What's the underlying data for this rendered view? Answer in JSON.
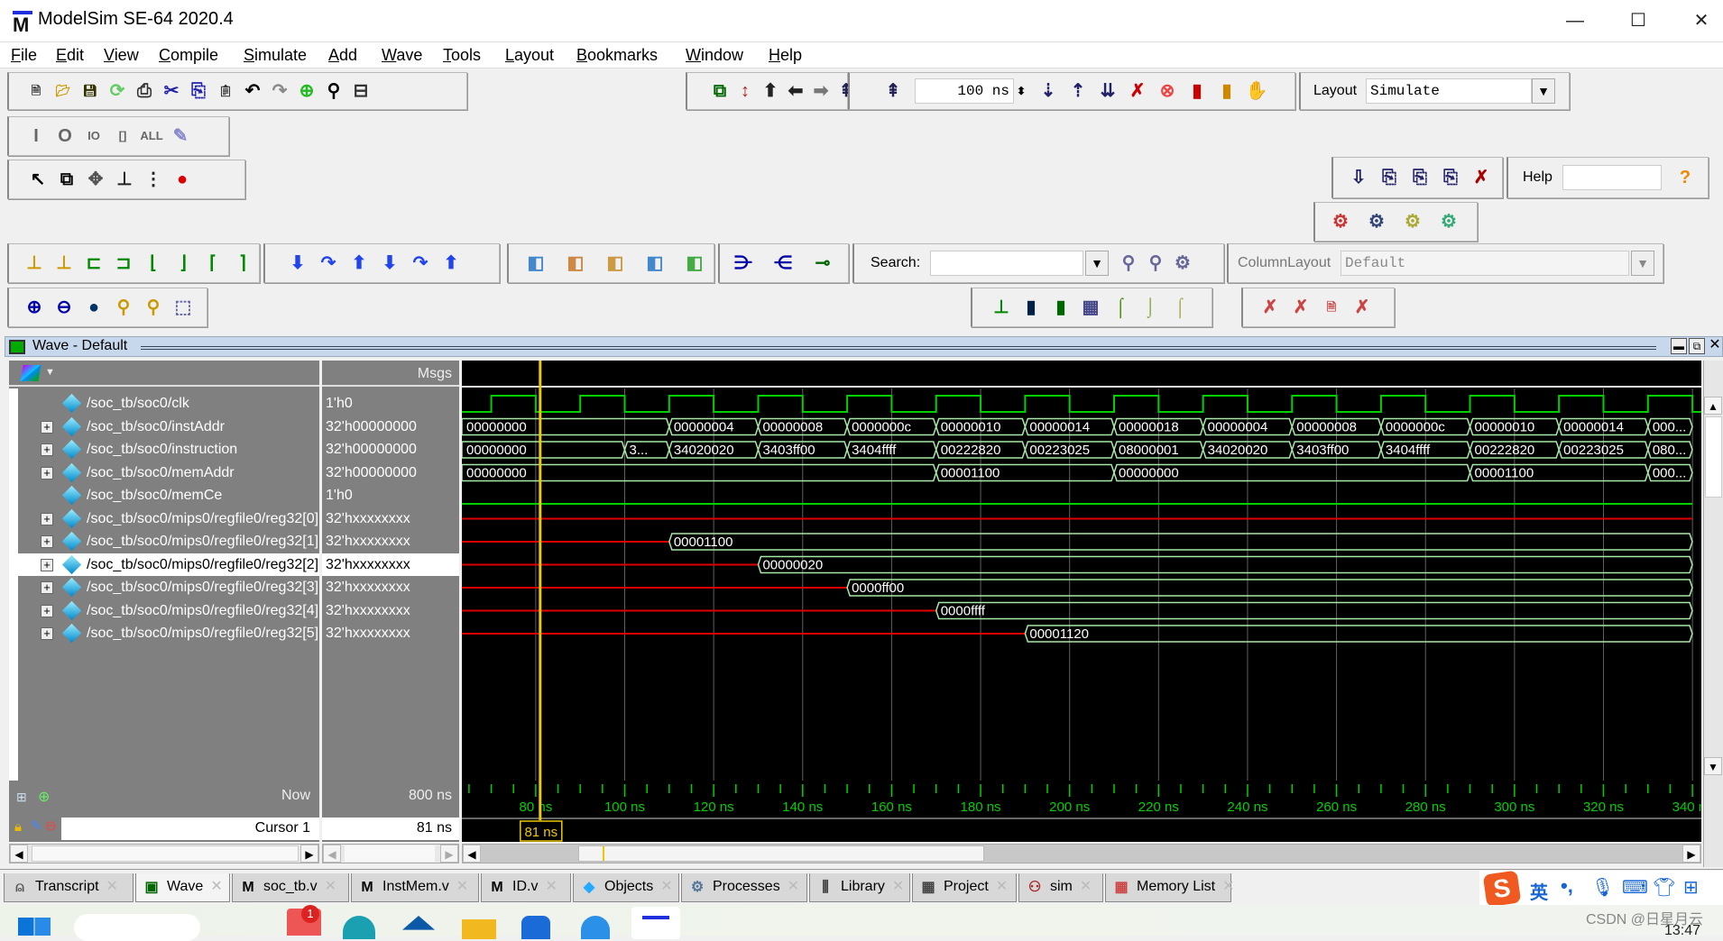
{
  "window": {
    "title": "ModelSim SE-64 2020.4",
    "controls": [
      "minimize",
      "maximize",
      "close"
    ]
  },
  "menu": [
    "File",
    "Edit",
    "View",
    "Compile",
    "Simulate",
    "Add",
    "Wave",
    "Tools",
    "Layout",
    "Bookmarks",
    "Window",
    "Help"
  ],
  "toolbar": {
    "run_length": "100 ns",
    "layout_label": "Layout",
    "layout_value": "Simulate",
    "help_label": "Help",
    "help_value": "",
    "search_label": "Search:",
    "search_value": "",
    "column_layout_label": "ColumnLayout",
    "column_layout_value": "Default",
    "groups": [
      [
        "new-file-icon",
        "open-folder-icon",
        "save-icon",
        "reload-icon",
        "print-icon",
        "cut-icon",
        "copy-icon",
        "paste-icon",
        "undo-icon",
        "redo-icon",
        "add-icon",
        "find-icon",
        "hierarchy-icon"
      ],
      [
        "compile-icon",
        "restart-icon",
        "up-icon",
        "back-icon",
        "forward-icon",
        "run-length-icon"
      ],
      [
        "run-icon",
        "continue-icon",
        "run-all-icon",
        "break-icon",
        "stop-icon",
        "performance-icon",
        "memory-profile-icon",
        "hand-icon"
      ],
      [
        "filter-input-icon",
        "filter-output-icon",
        "filter-inout-icon",
        "filter-internal-icon",
        "filter-all-icon",
        "wildcard-icon"
      ],
      [
        "select-mode-icon",
        "zoom-mode-icon",
        "pan-mode-icon",
        "cursor-mode-icon",
        "edit-mode-icon",
        "stop-light-icon"
      ],
      [
        "step-into-icon",
        "step-icon",
        "step-out-icon",
        "step-over-icon",
        "step-back-icon"
      ],
      [
        "gear-red-icon",
        "gear-blue-icon",
        "gear-yellow-icon",
        "gear-green-icon"
      ],
      [
        "help-search-icon"
      ],
      [
        "insert-cursor-icon",
        "delete-cursor-icon",
        "prev-edge-icon",
        "next-edge-icon",
        "prev-falling-icon",
        "next-falling-icon",
        "prev-rising-icon",
        "next-rising-icon"
      ],
      [
        "step-down-icon",
        "step-over-arrow-icon",
        "step-up-icon",
        "step-down-group-icon",
        "step-over-group-icon",
        "step-up-group-icon"
      ],
      [
        "add-wave-icon",
        "remove-wave-icon",
        "edit-wave-icon",
        "save-wave-icon",
        "export-wave-icon"
      ],
      [
        "expand-icon",
        "collapse-icon",
        "trace-icon"
      ],
      [
        "find-prev-icon",
        "find-next-icon",
        "search-options-icon"
      ],
      [
        "zoom-in-icon",
        "zoom-out-icon",
        "zoom-full-icon",
        "zoom-cursor-icon",
        "zoom-cursors-icon",
        "zoom-region-icon"
      ],
      [
        "wave-line-icon",
        "wave-bar-icon",
        "wave-fill-icon",
        "wave-grid-icon",
        "edge-icon",
        "edge-falling-icon",
        "edge-rising-icon"
      ],
      [
        "prev-diff-icon",
        "next-diff-icon",
        "diff-doc-icon",
        "clear-diff-icon"
      ]
    ]
  },
  "wave": {
    "title": "Wave - Default",
    "msgs_label": "Msgs",
    "selected_row": 7,
    "signals": [
      {
        "name": "/soc_tb/soc0/clk",
        "value": "1'h0",
        "kind": "clock",
        "expandable": false,
        "period_ns": 20,
        "rise_ns": 70,
        "high_ns": 10
      },
      {
        "name": "/soc_tb/soc0/instAddr",
        "value": "32'h00000000",
        "kind": "bus",
        "expandable": true,
        "segments": [
          [
            0,
            "00000000"
          ],
          [
            110,
            "00000004"
          ],
          [
            130,
            "00000008"
          ],
          [
            150,
            "0000000c"
          ],
          [
            170,
            "00000010"
          ],
          [
            190,
            "00000014"
          ],
          [
            210,
            "00000018"
          ],
          [
            230,
            "00000004"
          ],
          [
            250,
            "00000008"
          ],
          [
            270,
            "0000000c"
          ],
          [
            290,
            "00000010"
          ],
          [
            310,
            "00000014"
          ],
          [
            330,
            "000..."
          ]
        ]
      },
      {
        "name": "/soc_tb/soc0/instruction",
        "value": "32'h00000000",
        "kind": "bus",
        "expandable": true,
        "segments": [
          [
            0,
            "00000000"
          ],
          [
            100,
            "3..."
          ],
          [
            110,
            "34020020"
          ],
          [
            130,
            "3403ff00"
          ],
          [
            150,
            "3404ffff"
          ],
          [
            170,
            "00222820"
          ],
          [
            190,
            "00223025"
          ],
          [
            210,
            "08000001"
          ],
          [
            230,
            "34020020"
          ],
          [
            250,
            "3403ff00"
          ],
          [
            270,
            "3404ffff"
          ],
          [
            290,
            "00222820"
          ],
          [
            310,
            "00223025"
          ],
          [
            330,
            "080..."
          ]
        ]
      },
      {
        "name": "/soc_tb/soc0/memAddr",
        "value": "32'h00000000",
        "kind": "bus",
        "expandable": true,
        "segments": [
          [
            0,
            "00000000"
          ],
          [
            170,
            "00001100"
          ],
          [
            210,
            "00000000"
          ],
          [
            290,
            "00001100"
          ],
          [
            330,
            "000..."
          ]
        ]
      },
      {
        "name": "/soc_tb/soc0/memCe",
        "value": "1'h0",
        "kind": "bit",
        "expandable": false,
        "level": 0
      },
      {
        "name": "/soc_tb/soc0/mips0/regfile0/reg32[0]",
        "value": "32'hxxxxxxxx",
        "kind": "bus",
        "expandable": true,
        "segments": [
          [
            0,
            "x"
          ]
        ]
      },
      {
        "name": "/soc_tb/soc0/mips0/regfile0/reg32[1]",
        "value": "32'hxxxxxxxx",
        "kind": "bus",
        "expandable": true,
        "segments": [
          [
            0,
            "x"
          ],
          [
            110,
            "00001100"
          ]
        ]
      },
      {
        "name": "/soc_tb/soc0/mips0/regfile0/reg32[2]",
        "value": "32'hxxxxxxxx",
        "kind": "bus",
        "expandable": true,
        "segments": [
          [
            0,
            "x"
          ],
          [
            130,
            "00000020"
          ]
        ]
      },
      {
        "name": "/soc_tb/soc0/mips0/regfile0/reg32[3]",
        "value": "32'hxxxxxxxx",
        "kind": "bus",
        "expandable": true,
        "segments": [
          [
            0,
            "x"
          ],
          [
            150,
            "0000ff00"
          ]
        ]
      },
      {
        "name": "/soc_tb/soc0/mips0/regfile0/reg32[4]",
        "value": "32'hxxxxxxxx",
        "kind": "bus",
        "expandable": true,
        "segments": [
          [
            0,
            "x"
          ],
          [
            170,
            "0000ffff"
          ]
        ]
      },
      {
        "name": "/soc_tb/soc0/mips0/regfile0/reg32[5]",
        "value": "32'hxxxxxxxx",
        "kind": "bus",
        "expandable": true,
        "segments": [
          [
            0,
            "x"
          ],
          [
            190,
            "00001120"
          ]
        ]
      }
    ],
    "visible_range_ns": [
      63.4,
      342
    ],
    "tick_labels": [
      "80 ns",
      "100 ns",
      "120 ns",
      "140 ns",
      "160 ns",
      "180 ns",
      "200 ns",
      "220 ns",
      "240 ns",
      "260 ns",
      "280 ns",
      "300 ns",
      "320 ns",
      "340 ns"
    ],
    "tick_values_ns": [
      80,
      100,
      120,
      140,
      160,
      180,
      200,
      220,
      240,
      260,
      280,
      300,
      320,
      340
    ],
    "now_label": "Now",
    "now_value": "800 ns",
    "cursor_label": "Cursor 1",
    "cursor_value": "81 ns",
    "cursor_ns": 81,
    "colors": {
      "clock": "#00d000",
      "bus": "#a8e8a8",
      "unknown": "#e00000",
      "cursor": "#f0c800",
      "grid": "#606060",
      "text": "#ffffff",
      "tick": "#00d000"
    }
  },
  "tabs": [
    {
      "label": "Transcript",
      "icon": "transcript-icon"
    },
    {
      "label": "Wave",
      "icon": "wave-icon",
      "active": true
    },
    {
      "label": "soc_tb.v",
      "icon": "modelsim-file-icon"
    },
    {
      "label": "InstMem.v",
      "icon": "modelsim-file-icon"
    },
    {
      "label": "ID.v",
      "icon": "modelsim-file-icon"
    },
    {
      "label": "Objects",
      "icon": "objects-icon"
    },
    {
      "label": "Processes",
      "icon": "processes-gear-icon"
    },
    {
      "label": "Library",
      "icon": "library-icon"
    },
    {
      "label": "Project",
      "icon": "project-icon"
    },
    {
      "label": "sim",
      "icon": "sim-icon"
    },
    {
      "label": "Memory List",
      "icon": "memory-list-icon"
    }
  ],
  "ime": {
    "mode": "英",
    "icons": [
      "sogou-logo-icon",
      "punctuation-icon",
      "microphone-icon",
      "keyboard-icon",
      "skin-icon",
      "apps-icon"
    ]
  },
  "watermark": "CSDN @日星月云",
  "taskbar": {
    "clock": "13:47",
    "badge": "1"
  }
}
